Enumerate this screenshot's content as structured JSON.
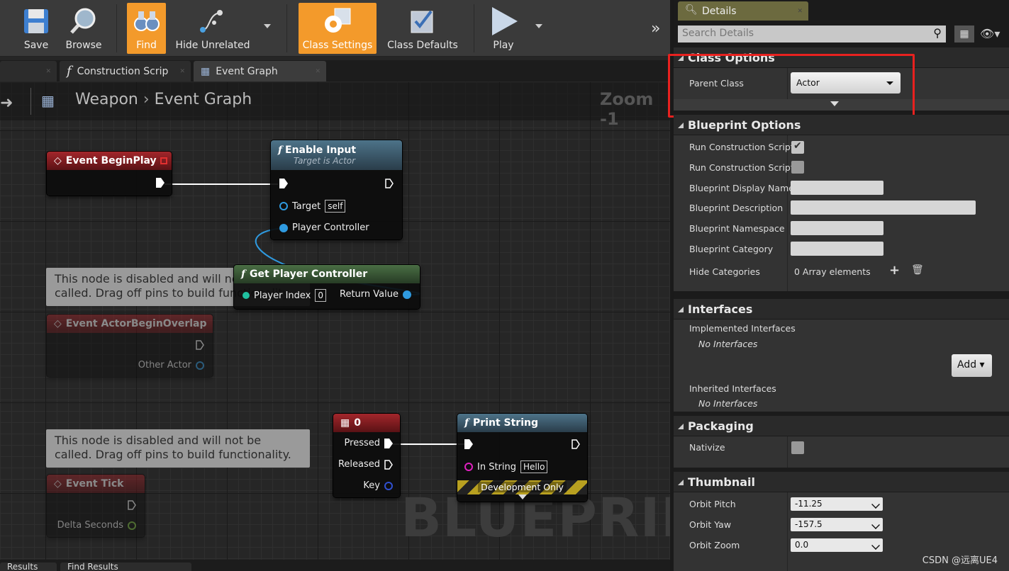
{
  "toolbar": {
    "save": "Save",
    "browse": "Browse",
    "find": "Find",
    "hide_unrelated": "Hide Unrelated",
    "class_settings": "Class Settings",
    "class_defaults": "Class Defaults",
    "play": "Play"
  },
  "tabs": {
    "construction": "Construction Scrip",
    "event_graph": "Event Graph"
  },
  "breadcrumb": {
    "blueprint": "Weapon",
    "graph": "Event Graph",
    "zoom": "Zoom -1"
  },
  "watermark": "BLUEPRINT",
  "nodes": {
    "begin_play": {
      "title": "Event BeginPlay"
    },
    "enable_input": {
      "title": "Enable Input",
      "subtitle": "Target is Actor",
      "target": "Target",
      "self": "self",
      "player_controller": "Player Controller"
    },
    "get_player_controller": {
      "title": "Get Player Controller",
      "player_index": "Player Index",
      "index_value": "0",
      "return_value": "Return Value"
    },
    "overlap": {
      "title": "Event ActorBeginOverlap",
      "other_actor": "Other Actor"
    },
    "tick": {
      "title": "Event Tick",
      "delta": "Delta Seconds"
    },
    "key0": {
      "title": "0",
      "pressed": "Pressed",
      "released": "Released",
      "key": "Key"
    },
    "print_string": {
      "title": "Print String",
      "in_string": "In String",
      "hello": "Hello",
      "dev_only": "Development Only"
    }
  },
  "comments": {
    "c1": "This node is disabled and will not be called. Drag off pins to build functionality.",
    "c2": "This node is disabled and will not be called. Drag off pins to build functionality."
  },
  "bottom_tabs": {
    "a": "Results",
    "b": "Find Results"
  },
  "details": {
    "tab": "Details",
    "search_placeholder": "Search Details",
    "class_options": {
      "header": "Class Options",
      "parent_class_label": "Parent Class",
      "parent_class": "Actor"
    },
    "blueprint_options": {
      "header": "Blueprint Options",
      "run_cs1": "Run Construction Script",
      "run_cs2": "Run Construction Script",
      "display_name": "Blueprint Display Name",
      "description": "Blueprint Description",
      "namespace": "Blueprint Namespace",
      "category": "Blueprint Category",
      "hide_categories": "Hide Categories",
      "array_elements": "0 Array elements"
    },
    "interfaces": {
      "header": "Interfaces",
      "implemented": "Implemented Interfaces",
      "no1": "No Interfaces",
      "add": "Add",
      "inherited": "Inherited Interfaces",
      "no2": "No Interfaces"
    },
    "packaging": {
      "header": "Packaging",
      "nativize": "Nativize"
    },
    "thumbnail": {
      "header": "Thumbnail",
      "orbit_pitch_label": "Orbit Pitch",
      "orbit_pitch": "-11.25",
      "orbit_yaw_label": "Orbit Yaw",
      "orbit_yaw": "-157.5",
      "orbit_zoom_label": "Orbit Zoom",
      "orbit_zoom": "0.0"
    }
  },
  "credit": "CSDN @远离UE4"
}
